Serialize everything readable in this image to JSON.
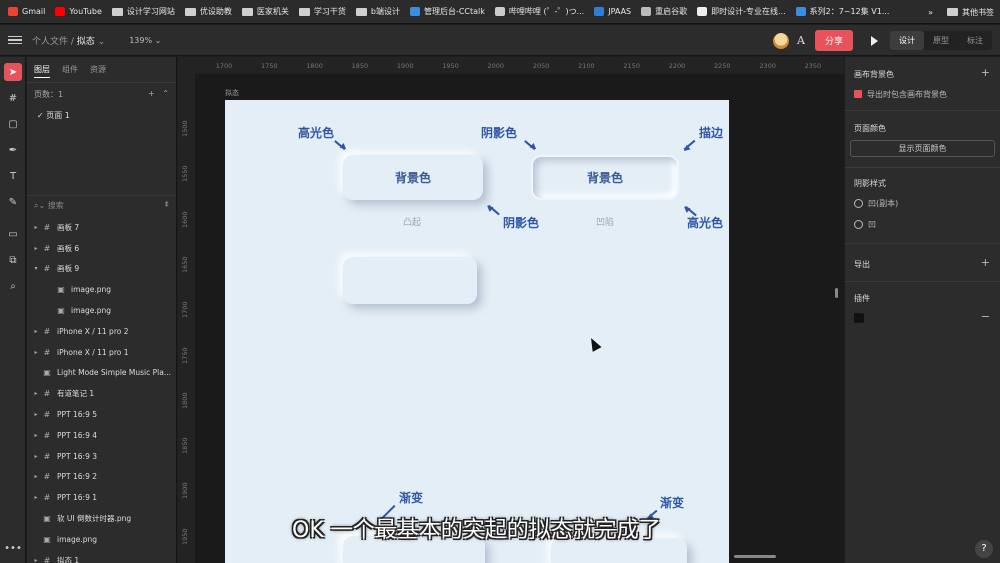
{
  "bookmarks": [
    {
      "label": "Gmail",
      "color": "#ea4335",
      "kind": "app"
    },
    {
      "label": "YouTube",
      "color": "#ff0000",
      "kind": "app"
    },
    {
      "label": "设计学习网站",
      "kind": "folder"
    },
    {
      "label": "优设助教",
      "kind": "folder"
    },
    {
      "label": "医家机关",
      "kind": "folder"
    },
    {
      "label": "学习干货",
      "kind": "folder"
    },
    {
      "label": "b端设计",
      "kind": "folder"
    },
    {
      "label": "管理后台-CCtalk",
      "color": "#3b8de0",
      "kind": "app"
    },
    {
      "label": "哔哩哔哩 (゜-゜)つ...",
      "color": "#cccccc",
      "kind": "app"
    },
    {
      "label": "JPAAS",
      "color": "#2f7fd8",
      "kind": "app"
    },
    {
      "label": "重启谷歌",
      "color": "#bbbbbb",
      "kind": "app"
    },
    {
      "label": "即时设计-专业在线...",
      "color": "#eeeeee",
      "kind": "app"
    },
    {
      "label": "系列2：7~12集 V1...",
      "color": "#3b8de0",
      "kind": "app"
    }
  ],
  "bookmarks_more": "»",
  "bookmarks_other": "其他书签",
  "toolbar": {
    "crumb_parent": "个人文件 /",
    "crumb_current": "拟态",
    "zoom": "139%",
    "share_label": "分享",
    "modes": [
      "设计",
      "原型",
      "标注"
    ]
  },
  "layers_panel": {
    "tabs": [
      "图层",
      "组件",
      "资源"
    ],
    "pages_label": "页数：1",
    "page_item": "页面 1",
    "search_placeholder": "搜索",
    "items": [
      {
        "label": "画板 7",
        "icon": "#",
        "caret": "▸",
        "child": false
      },
      {
        "label": "画板 6",
        "icon": "#",
        "caret": "▸",
        "child": false
      },
      {
        "label": "画板 9",
        "icon": "#",
        "caret": "▾",
        "child": false
      },
      {
        "label": "image.png",
        "icon": "▣",
        "caret": "",
        "child": true
      },
      {
        "label": "image.png",
        "icon": "▣",
        "caret": "",
        "child": true
      },
      {
        "label": "iPhone X / 11 pro 2",
        "icon": "#",
        "caret": "▸",
        "child": false
      },
      {
        "label": "iPhone X / 11 pro 1",
        "icon": "#",
        "caret": "▸",
        "child": false
      },
      {
        "label": "Light Mode Simple Music Pla...",
        "icon": "▣",
        "caret": "",
        "child": false
      },
      {
        "label": "有道笔记 1",
        "icon": "#",
        "caret": "▸",
        "child": false
      },
      {
        "label": "PPT 16:9 5",
        "icon": "#",
        "caret": "▸",
        "child": false
      },
      {
        "label": "PPT 16:9 4",
        "icon": "#",
        "caret": "▸",
        "child": false
      },
      {
        "label": "PPT 16:9 3",
        "icon": "#",
        "caret": "▸",
        "child": false
      },
      {
        "label": "PPT 16:9 2",
        "icon": "#",
        "caret": "▸",
        "child": false
      },
      {
        "label": "PPT 16:9 1",
        "icon": "#",
        "caret": "▸",
        "child": false
      },
      {
        "label": "软 UI 倒数计时器.png",
        "icon": "▣",
        "caret": "",
        "child": false
      },
      {
        "label": "image.png",
        "icon": "▣",
        "caret": "",
        "child": false
      },
      {
        "label": "拟态 1",
        "icon": "#",
        "caret": "▸",
        "child": false
      }
    ]
  },
  "canvas": {
    "ruler_h": [
      "1700",
      "1750",
      "1800",
      "1850",
      "1900",
      "1950",
      "2000",
      "2050",
      "2100",
      "2150",
      "2200",
      "2250",
      "2300",
      "2350"
    ],
    "ruler_v": [
      "1500",
      "1550",
      "1600",
      "1650",
      "1700",
      "1750",
      "1800",
      "1850",
      "1900",
      "1950",
      "2000"
    ],
    "frame_label": "拟态",
    "raised_text": "背景色",
    "inset_text": "背景色",
    "raised_caption": "凸起",
    "inset_caption": "凹陷",
    "notes": {
      "highlight_left": "高光色",
      "shadow_top": "阴影色",
      "stroke": "描边",
      "shadow_mid": "阴影色",
      "highlight_right": "高光色",
      "gradient_left": "渐变",
      "gradient_right": "渐变"
    },
    "subtitle": "OK 一个最基本的突起的拟态就完成了"
  },
  "right_panel": {
    "canvas_bg_title": "画布背景色",
    "export_bg_label": "导出时包含画布背景色",
    "page_color_title": "页面颜色",
    "show_page_color_btn": "显示页面颜色",
    "shadow_style_title": "阴影样式",
    "shadow_styles": [
      "凹(副本)",
      "凹"
    ],
    "export_title": "导出",
    "plugins_title": "插件"
  },
  "colors": {
    "accent": "#e8525a",
    "artboard_bg": "#e4eef6",
    "annotation": "#2f56a5"
  }
}
